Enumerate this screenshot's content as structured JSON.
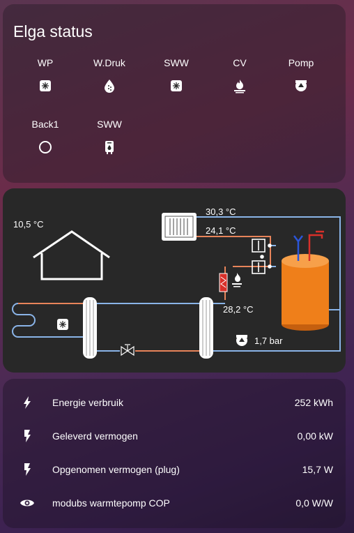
{
  "status": {
    "title": "Elga status",
    "entities": [
      {
        "label": "WP",
        "icon": "snowflake-sun-icon"
      },
      {
        "label": "W.Druk",
        "icon": "water-drop-icon"
      },
      {
        "label": "SWW",
        "icon": "snowflake-sun-icon"
      },
      {
        "label": "CV",
        "icon": "flame-icon"
      },
      {
        "label": "Pomp",
        "icon": "pump-icon"
      },
      {
        "label": "Back1",
        "icon": "circle-outline-icon"
      },
      {
        "label": "SWW",
        "icon": "water-boiler-icon"
      }
    ]
  },
  "schema": {
    "outdoor_temp": "10,5 °C",
    "supply_temp": "30,3 °C",
    "return_temp": "24,1 °C",
    "flow_temp": "28,2 °C",
    "pressure": "1,7 bar",
    "colors": {
      "hot": "#e8845a",
      "cold": "#8ab4e8",
      "tank": "#ef7f1a"
    }
  },
  "sensors": [
    {
      "name": "Energie verbruik",
      "value": "252 kWh",
      "icon": "flash-icon"
    },
    {
      "name": "Geleverd vermogen",
      "value": "0,00 kW",
      "icon": "flash-outline-icon"
    },
    {
      "name": "Opgenomen vermogen (plug)",
      "value": "15,7 W",
      "icon": "flash-outline-icon"
    },
    {
      "name": "modubs warmtepomp COP",
      "value": "0,0 W/W",
      "icon": "eye-icon"
    }
  ]
}
